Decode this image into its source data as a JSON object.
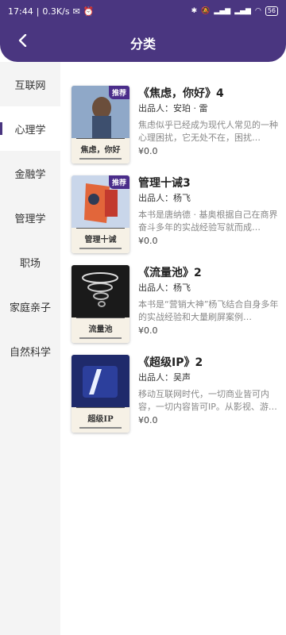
{
  "status": {
    "time": "17:44",
    "speed": "0.3K/s",
    "battery": "56"
  },
  "header": {
    "title": "分类"
  },
  "sidebar": {
    "items": [
      {
        "label": "互联网"
      },
      {
        "label": "心理学"
      },
      {
        "label": "金融学"
      },
      {
        "label": "管理学"
      },
      {
        "label": "职场"
      },
      {
        "label": "家庭亲子"
      },
      {
        "label": "自然科学"
      }
    ],
    "active_index": 1
  },
  "books": [
    {
      "title": "《焦虑，你好》4",
      "author_prefix": "出品人：",
      "author": "安珀 · 雷",
      "desc": "焦虑似乎已经成为现代人常见的一种心理困扰，它无处不在，困扰…",
      "price": "¥0.0",
      "badge": "推荐",
      "cover_text": "焦虑，你好",
      "cover_color": "#8fa8c8"
    },
    {
      "title": "管理十诫3",
      "author_prefix": "出品人：",
      "author": "杨飞",
      "desc": "本书是唐纳德 · 基奥根据自己在商界奋斗多年的实战经验写就而成…",
      "price": "¥0.0",
      "badge": "推荐",
      "cover_text": "管理十诫",
      "cover_color": "#c9d6ea"
    },
    {
      "title": "《流量池》2",
      "author_prefix": "出品人：",
      "author": "杨飞",
      "desc": "本书是“营销大神”杨飞结合自身多年的实战经验和大量刷屏案例…",
      "price": "¥0.0",
      "badge": "",
      "cover_text": "流量池",
      "cover_color": "#1a1a1a"
    },
    {
      "title": "《超级IP》2",
      "author_prefix": "出品人：",
      "author": "吴声",
      "desc": "移动互联网时代，一切商业皆可内容，一切内容皆可IP。从影视、游…",
      "price": "¥0.0",
      "badge": "",
      "cover_text": "超级IP",
      "cover_color": "#1f2a6b"
    }
  ]
}
